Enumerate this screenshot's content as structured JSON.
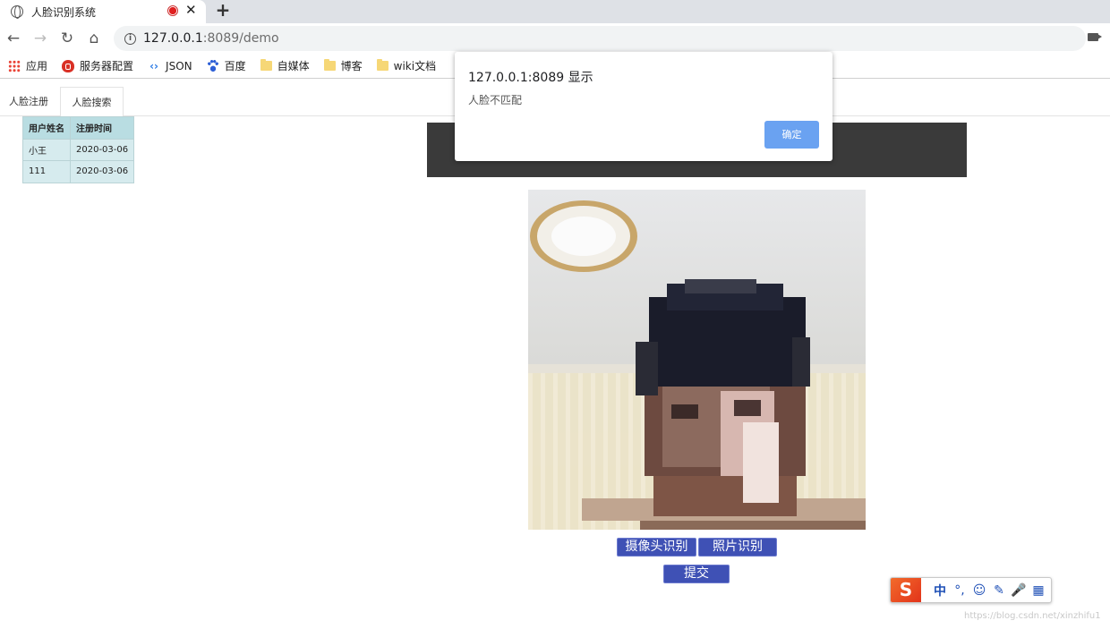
{
  "browser": {
    "tab_title": "人脸识别系统",
    "close_glyph": "✕",
    "newtab_glyph": "+",
    "url_host": "127.0.0.1",
    "url_rest": ":8089/demo",
    "nav": {
      "back": "←",
      "forward": "→",
      "reload": "↻",
      "home": "⌂"
    },
    "bookmarks": [
      {
        "label": "应用",
        "icon": "apps-icon"
      },
      {
        "label": "服务器配置",
        "icon": "shield-icon"
      },
      {
        "label": "JSON",
        "icon": "json-icon"
      },
      {
        "label": "百度",
        "icon": "baidu-paw-icon"
      },
      {
        "label": "自媒体",
        "icon": "folder-icon"
      },
      {
        "label": "博客",
        "icon": "folder-icon"
      },
      {
        "label": "wiki文档",
        "icon": "folder-icon"
      }
    ]
  },
  "page": {
    "tabs": [
      {
        "label": "人脸注册"
      },
      {
        "label": "人脸搜索"
      }
    ],
    "table": {
      "headers": [
        "用户姓名",
        "注册时间"
      ],
      "rows": [
        [
          "小王",
          "2020-03-06"
        ],
        [
          "111",
          "2020-03-06"
        ]
      ]
    },
    "buttons": {
      "camera": "摄像头识别",
      "photo": "照片识别",
      "submit": "提交"
    }
  },
  "alert": {
    "title": "127.0.0.1:8089 显示",
    "message": "人脸不匹配",
    "ok_label": "确定"
  },
  "ime": {
    "logo": "S",
    "items": [
      "中",
      "°,",
      "☺",
      "✎",
      "🎤",
      "▦"
    ]
  },
  "watermark": "https://blog.csdn.net/xinzhifu1",
  "colors": {
    "accent_button": "#3f51b5",
    "alert_ok": "#6aa2f1",
    "table_header": "#b9dde2",
    "table_cell": "#d6ebee",
    "banner": "#3a3a3a"
  }
}
